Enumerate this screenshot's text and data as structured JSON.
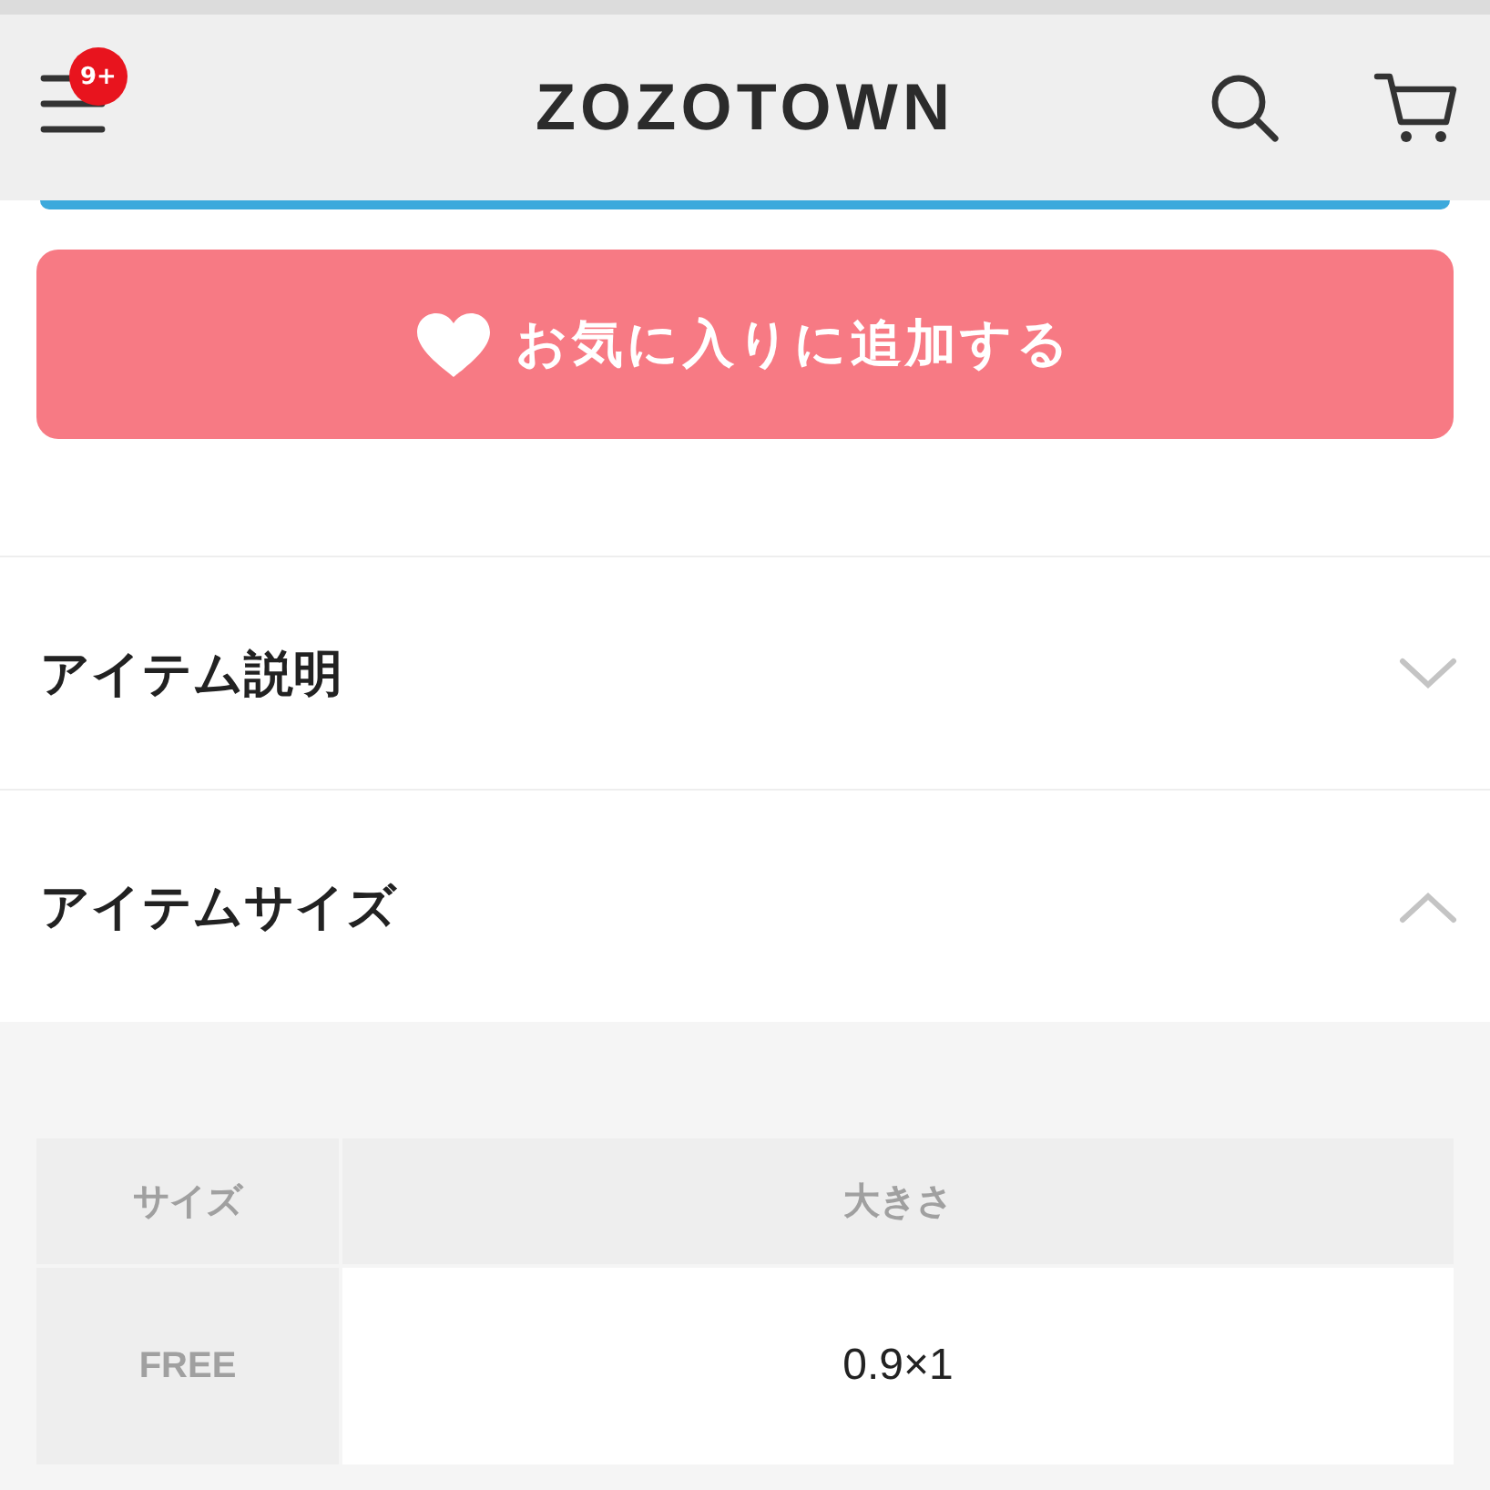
{
  "header": {
    "logo": "ZOZOTOWN",
    "menu_badge": "9+"
  },
  "favorite_button": {
    "label": "お気に入りに追加する"
  },
  "sections": [
    {
      "title": "アイテム説明",
      "expanded": false
    },
    {
      "title": "アイテムサイズ",
      "expanded": true,
      "size_table": {
        "columns": [
          "サイズ",
          "大きさ"
        ],
        "rows": [
          {
            "size": "FREE",
            "value": "0.9×1"
          }
        ]
      }
    }
  ]
}
